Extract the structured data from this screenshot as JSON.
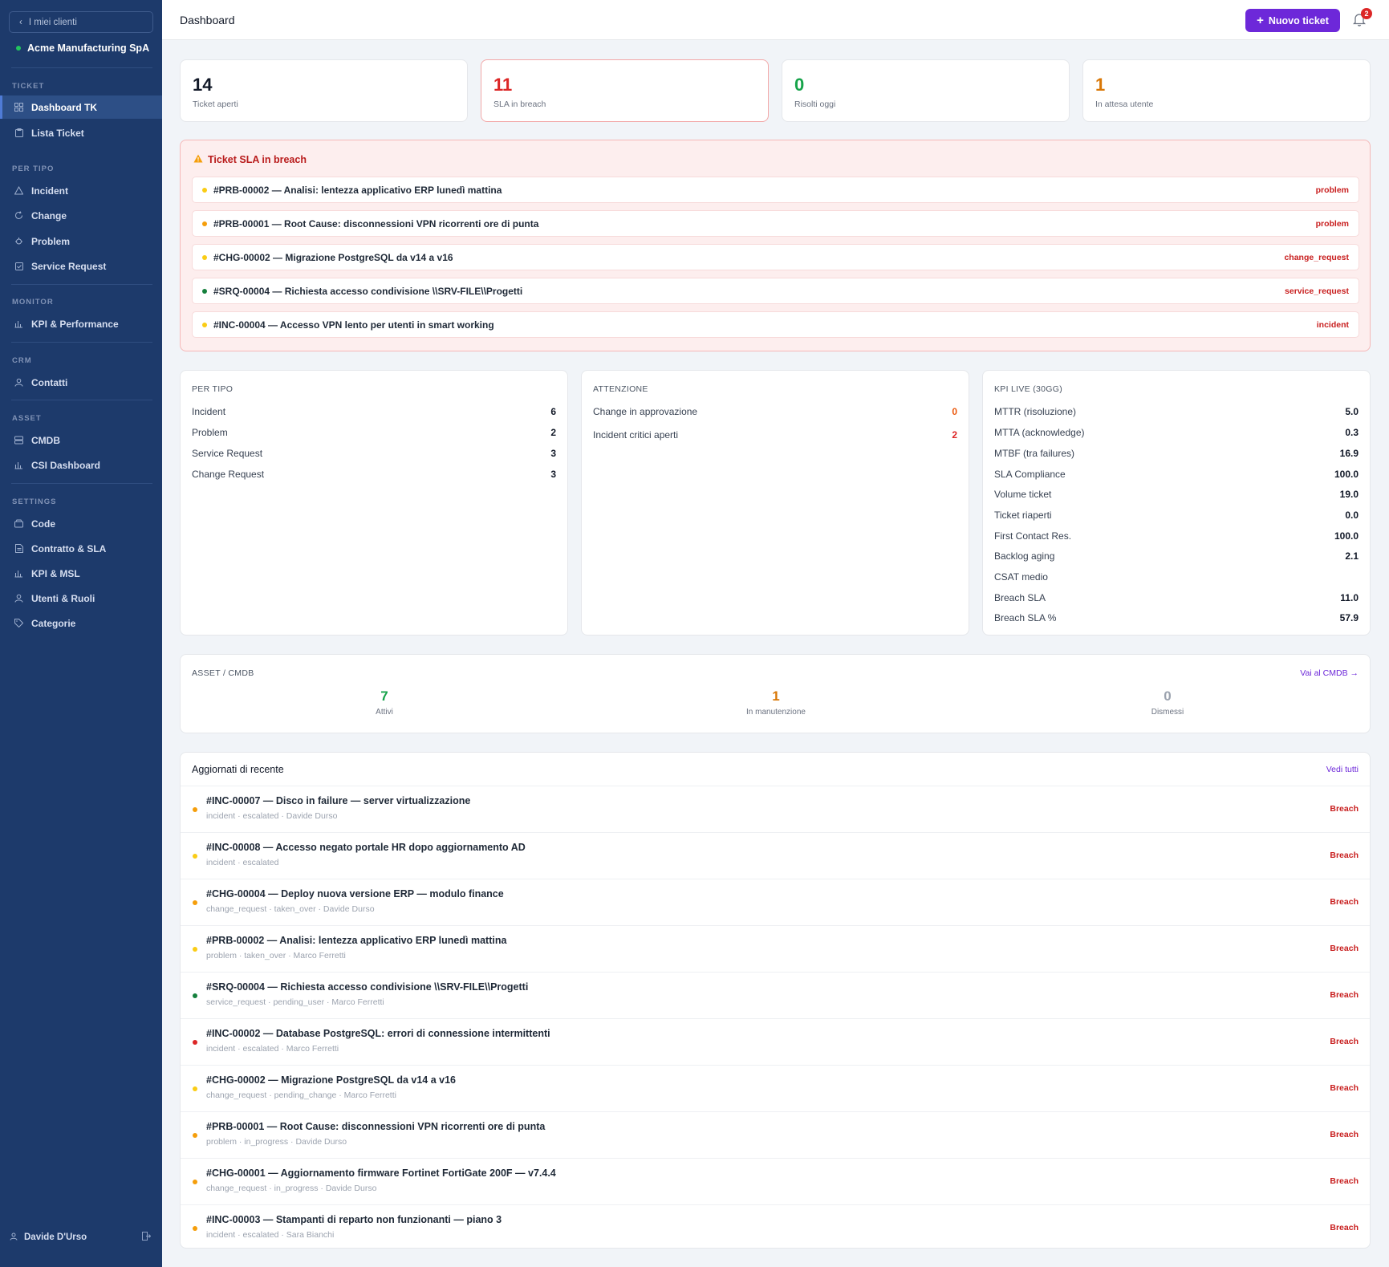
{
  "sidebar": {
    "back_label": "I miei clienti",
    "client_name": "Acme Manufacturing SpA",
    "sections": {
      "ticket": "TICKET",
      "per_tipo": "PER TIPO",
      "monitor": "MONITOR",
      "crm": "CRM",
      "asset": "ASSET",
      "settings": "SETTINGS"
    },
    "items": {
      "dashboard_tk": "Dashboard TK",
      "lista_ticket": "Lista Ticket",
      "incident": "Incident",
      "change": "Change",
      "problem": "Problem",
      "service_request": "Service Request",
      "kpi_performance": "KPI & Performance",
      "contatti": "Contatti",
      "cmdb": "CMDB",
      "csi_dashboard": "CSI Dashboard",
      "code": "Code",
      "contratto_sla": "Contratto & SLA",
      "kpi_msl": "KPI & MSL",
      "utenti_ruoli": "Utenti & Ruoli",
      "categorie": "Categorie"
    },
    "user_name": "Davide D'Urso"
  },
  "header": {
    "title": "Dashboard",
    "new_ticket_label": "Nuovo ticket",
    "notification_count": "2"
  },
  "stats": [
    {
      "value": "14",
      "label": "Ticket aperti",
      "color": "#111827"
    },
    {
      "value": "11",
      "label": "SLA in breach",
      "color": "#dc2626"
    },
    {
      "value": "0",
      "label": "Risolti oggi",
      "color": "#16a34a"
    },
    {
      "value": "1",
      "label": "In attesa utente",
      "color": "#d97706"
    }
  ],
  "breach": {
    "title": "Ticket SLA in breach",
    "rows": [
      {
        "text": "#PRB-00002 — Analisi: lentezza applicativo ERP lunedì mattina",
        "type": "problem",
        "dot": "#facc15"
      },
      {
        "text": "#PRB-00001 — Root Cause: disconnessioni VPN ricorrenti ore di punta",
        "type": "problem",
        "dot": "#f59e0b"
      },
      {
        "text": "#CHG-00002 — Migrazione PostgreSQL da v14 a v16",
        "type": "change_request",
        "dot": "#facc15"
      },
      {
        "text": "#SRQ-00004 — Richiesta accesso condivisione \\\\SRV-FILE\\\\Progetti",
        "type": "service_request",
        "dot": "#15803d"
      },
      {
        "text": "#INC-00004 — Accesso VPN lento per utenti in smart working",
        "type": "incident",
        "dot": "#facc15"
      }
    ]
  },
  "per_tipo": {
    "title": "PER TIPO",
    "rows": [
      {
        "label": "Incident",
        "value": "6"
      },
      {
        "label": "Problem",
        "value": "2"
      },
      {
        "label": "Service Request",
        "value": "3"
      },
      {
        "label": "Change Request",
        "value": "3"
      }
    ]
  },
  "attenzione": {
    "title": "ATTENZIONE",
    "rows": [
      {
        "label": "Change in approvazione",
        "value": "0",
        "color": "#ea580c"
      },
      {
        "label": "Incident critici aperti",
        "value": "2",
        "color": "#dc2626"
      }
    ]
  },
  "kpi_live": {
    "title": "KPI LIVE (30GG)",
    "rows": [
      {
        "label": "MTTR (risoluzione)",
        "value": "5.0"
      },
      {
        "label": "MTTA (acknowledge)",
        "value": "0.3"
      },
      {
        "label": "MTBF (tra failures)",
        "value": "16.9"
      },
      {
        "label": "SLA Compliance",
        "value": "100.0"
      },
      {
        "label": "Volume ticket",
        "value": "19.0"
      },
      {
        "label": "Ticket riaperti",
        "value": "0.0"
      },
      {
        "label": "First Contact Res.",
        "value": "100.0"
      },
      {
        "label": "Backlog aging",
        "value": "2.1"
      },
      {
        "label": "CSAT medio",
        "value": ""
      },
      {
        "label": "Breach SLA",
        "value": "11.0"
      },
      {
        "label": "Breach SLA %",
        "value": "57.9"
      }
    ]
  },
  "asset": {
    "title": "ASSET / CMDB",
    "link": "Vai al CMDB →",
    "items": [
      {
        "value": "7",
        "label": "Attivi",
        "color": "#16a34a"
      },
      {
        "value": "1",
        "label": "In manutenzione",
        "color": "#d97706"
      },
      {
        "value": "0",
        "label": "Dismessi",
        "color": "#9ca3af"
      }
    ]
  },
  "recent": {
    "title": "Aggiornati di recente",
    "link": "Vedi tutti",
    "rows": [
      {
        "title": "#INC-00007 — Disco in failure — server virtualizzazione",
        "meta": "incident · escalated · Davide Durso",
        "badge": "Breach",
        "dot": "#f59e0b"
      },
      {
        "title": "#INC-00008 — Accesso negato portale HR dopo aggiornamento AD",
        "meta": "incident · escalated",
        "badge": "Breach",
        "dot": "#facc15"
      },
      {
        "title": "#CHG-00004 — Deploy nuova versione ERP — modulo finance",
        "meta": "change_request · taken_over · Davide Durso",
        "badge": "Breach",
        "dot": "#f59e0b"
      },
      {
        "title": "#PRB-00002 — Analisi: lentezza applicativo ERP lunedì mattina",
        "meta": "problem · taken_over · Marco Ferretti",
        "badge": "Breach",
        "dot": "#facc15"
      },
      {
        "title": "#SRQ-00004 — Richiesta accesso condivisione \\\\SRV-FILE\\\\Progetti",
        "meta": "service_request · pending_user · Marco Ferretti",
        "badge": "Breach",
        "dot": "#15803d"
      },
      {
        "title": "#INC-00002 — Database PostgreSQL: errori di connessione intermittenti",
        "meta": "incident · escalated · Marco Ferretti",
        "badge": "Breach",
        "dot": "#dc2626"
      },
      {
        "title": "#CHG-00002 — Migrazione PostgreSQL da v14 a v16",
        "meta": "change_request · pending_change · Marco Ferretti",
        "badge": "Breach",
        "dot": "#facc15"
      },
      {
        "title": "#PRB-00001 — Root Cause: disconnessioni VPN ricorrenti ore di punta",
        "meta": "problem · in_progress · Davide Durso",
        "badge": "Breach",
        "dot": "#f59e0b"
      },
      {
        "title": "#CHG-00001 — Aggiornamento firmware Fortinet FortiGate 200F — v7.4.4",
        "meta": "change_request · in_progress · Davide Durso",
        "badge": "Breach",
        "dot": "#f59e0b"
      },
      {
        "title": "#INC-00003 — Stampanti di reparto non funzionanti — piano 3",
        "meta": "incident · escalated · Sara Bianchi",
        "badge": "Breach",
        "dot": "#f59e0b"
      }
    ]
  }
}
